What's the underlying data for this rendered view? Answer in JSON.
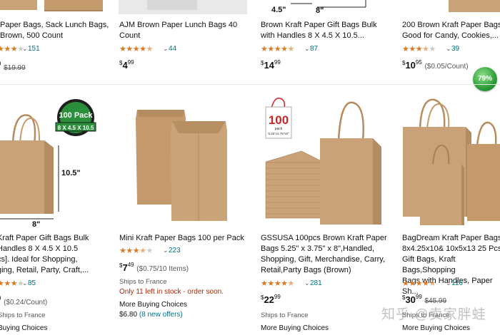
{
  "products_top": [
    {
      "title_l1": "Paper Bags, Sack Lunch Bags,",
      "title_l2": "Brown, 500 Count",
      "reviews": "151",
      "price_partial": "9",
      "list_price": "$19.99",
      "rating": 4.0
    },
    {
      "title_l1": "AJM Brown Paper Lunch Bags 40",
      "title_l2": "Count",
      "reviews": "44",
      "price_currency": "$",
      "price_whole": "4",
      "price_fraction": "99",
      "rating": 4.5
    },
    {
      "title_l1": "Brown Kraft Paper Gift Bags Bulk",
      "title_l2": "with Handles 8 X 4.5 X 10.5...",
      "reviews": "87",
      "price_currency": "$",
      "price_whole": "14",
      "price_fraction": "99",
      "image_labels": [
        "4.5\"",
        "8\""
      ],
      "rating": 4.5
    },
    {
      "title_l1": "200 Brown Kraft Paper Bags",
      "title_l2": "Good for Candy, Cookies,...",
      "reviews": "39",
      "price_currency": "$",
      "price_whole": "10",
      "price_fraction": "95",
      "unit_price": "($0.05/Count)",
      "rating": 3.5
    }
  ],
  "products_bottom": [
    {
      "title_lines": [
        "Kraft Paper Gift Bags Bulk",
        "Handles 8 X 4.5 X 10.5",
        "cs]. Ideal for Shopping,",
        "ging, Retail, Party, Craft,..."
      ],
      "reviews": "85",
      "price_partial": "9",
      "unit_price": "($0.24/Count)",
      "ships": "Ships to France",
      "more": "Buying Choices",
      "image_labels": {
        "badge_top": "100 Pack",
        "badge_bottom": "8 X 4.5 X 10.5",
        "height": "10.5\"",
        "width": "8\""
      },
      "rating": 4.0
    },
    {
      "title_lines": [
        "Mini Kraft Paper Bags 100 per Pack"
      ],
      "reviews": "223",
      "price_currency": "$",
      "price_whole": "7",
      "price_fraction": "49",
      "unit_price": "($0.75/10 Items)",
      "ships": "Ships to France",
      "stock": "Only 11 left in stock - order soon.",
      "more": "More Buying Choices",
      "more_price": "$6.80",
      "offers": "(8 new offers)",
      "rating": 3.5
    },
    {
      "title_lines": [
        "GSSUSA 100pcs Brown Kraft Paper",
        "Bags 5.25\" x 3.75\" x 8\",Handled,",
        "Shopping, Gift, Merchandise, Carry,",
        "Retail,Party Bags (Brown)"
      ],
      "reviews": "281",
      "price_currency": "$",
      "price_whole": "22",
      "price_fraction": "99",
      "ships": "Ships to France",
      "more": "More Buying Choices",
      "image_labels": {
        "count": "100",
        "sub1": "pack",
        "sub2": "5.25\"x3.75\"x8\""
      },
      "rating": 4.5
    },
    {
      "title_lines": [
        "BagDream Kraft Paper Bags",
        "8x4.25x10& 10x5x13 25 Pcs",
        "Gift Bags, Kraft Bags,Shopping",
        "Bags with Handles, Paper Sh..."
      ],
      "reviews": "116",
      "price_currency": "$",
      "price_whole": "30",
      "price_fraction": "99",
      "list_price": "$45.99",
      "ships": "Ships to France",
      "more": "More Buying Choices",
      "rating": 4.5
    }
  ],
  "badge": {
    "label": "79%",
    "color": "#2e9e39"
  },
  "watermark": "知乎 @卖家胖蛙",
  "colors": {
    "star": "#de7921",
    "link": "#007185",
    "stock": "#b12704",
    "kraft": "#c9a27a"
  }
}
